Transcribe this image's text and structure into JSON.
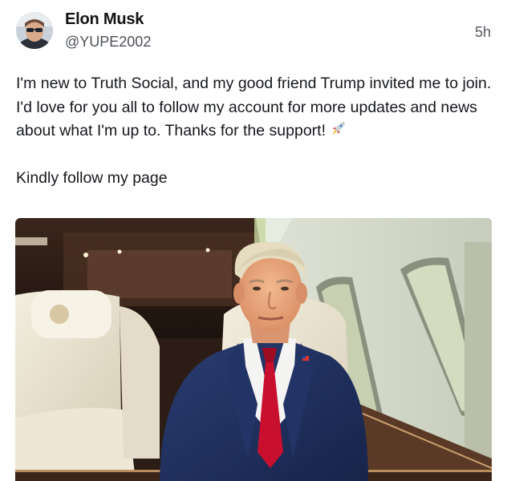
{
  "post": {
    "author": {
      "name": "Elon Musk",
      "handle": "@YUPE2002"
    },
    "timestamp": "5h",
    "text_lines": [
      "I'm new to Truth Social, and my good friend Trump invited me to join. I'd love for you all to follow my account for more updates and news about what I'm up to. Thanks for the support!",
      "Kindly follow my page"
    ],
    "emoji": "rocket-icon",
    "media": {
      "kind": "video-still"
    }
  },
  "colors": {
    "name": "#111111",
    "handle": "#4b5057",
    "text": "#15181c",
    "suit": "#1f2f5e",
    "tie": "#c8102e",
    "seat": "#e9e3d2"
  }
}
